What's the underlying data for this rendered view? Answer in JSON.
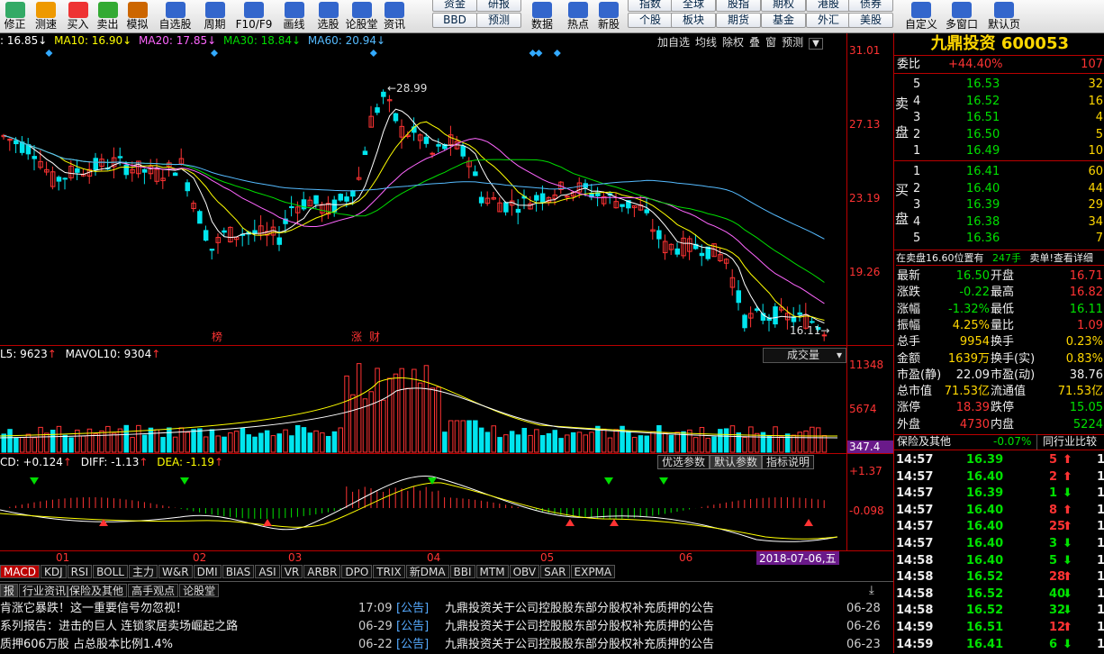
{
  "toolbar": {
    "buttons": [
      {
        "label": "修正",
        "icon": "refresh-icon",
        "color": "#3a6"
      },
      {
        "label": "测速",
        "icon": "clock-icon",
        "color": "#e90"
      },
      {
        "label": "买入",
        "icon": "buy-icon",
        "color": "#e33"
      },
      {
        "label": "卖出",
        "icon": "sell-icon",
        "color": "#3a3"
      },
      {
        "label": "模拟",
        "icon": "hammer-icon",
        "color": "#c60"
      },
      {
        "label": "自选股",
        "icon": "favorites-icon",
        "color": "#36c"
      },
      {
        "label": "周期",
        "icon": "cycle-icon",
        "color": "#36c"
      },
      {
        "label": "F10/F9",
        "icon": "f10-icon",
        "color": "#36c"
      },
      {
        "label": "画线",
        "icon": "pen-icon",
        "color": "#36c"
      },
      {
        "label": "选股",
        "icon": "filter-icon",
        "color": "#36c"
      },
      {
        "label": "论股堂",
        "icon": "forum-icon",
        "color": "#36c"
      },
      {
        "label": "资讯",
        "icon": "news-icon",
        "color": "#36c"
      }
    ],
    "small_buttons": [
      "资金",
      "研报",
      "BBD",
      "预测",
      "全球",
      "股指",
      "期货",
      "港股",
      "债券",
      "指数",
      "期权",
      "个股",
      "板块",
      "基金",
      "外汇",
      "美股"
    ],
    "right_buttons": [
      {
        "label": "数据",
        "icon": "pe-icon"
      },
      {
        "label": "热点",
        "icon": "hot-icon"
      },
      {
        "label": "新股",
        "icon": "flag-icon"
      },
      {
        "label": "自定义",
        "icon": "custom-icon"
      },
      {
        "label": "多窗口",
        "icon": "windows-icon"
      },
      {
        "label": "默认页",
        "icon": "home-icon"
      }
    ]
  },
  "ma_legend": {
    "ma5": ": 16.85",
    "ma10": "MA10: 16.90",
    "ma20": "MA20: 17.85",
    "ma30": "MA30: 18.84",
    "ma60": "MA60: 20.94"
  },
  "chart_buttons": [
    "加自选",
    "均线",
    "除权",
    "叠",
    "窗",
    "预测"
  ],
  "price_axis": [
    "31.01",
    "27.13",
    "23.19",
    "19.26"
  ],
  "price_labels": {
    "high": "28.99",
    "low": "16.11"
  },
  "markers": [
    "榜",
    "涨",
    "财"
  ],
  "vol_legend": {
    "l5": "L5: 9623",
    "mavol10": "MAVOL10: 9304"
  },
  "vol_select": "成交量",
  "vol_axis": [
    "11348",
    "5674",
    "347.4"
  ],
  "macd_legend": {
    "macd": "CD: +0.124",
    "diff": "DIFF: -1.13",
    "dea": "DEA: -1.19"
  },
  "macd_buttons": [
    "优选参数",
    "默认参数",
    "指标说明"
  ],
  "macd_axis": [
    "+1.37",
    "-0.098"
  ],
  "months": [
    "01",
    "02",
    "03",
    "04",
    "05",
    "06"
  ],
  "date_label": "2018-07-06,五",
  "indicator_tabs": [
    "MACD",
    "KDJ",
    "RSI",
    "BOLL",
    "主力",
    "W&R",
    "DMI",
    "BIAS",
    "ASI",
    "VR",
    "ARBR",
    "DPO",
    "TRIX",
    "新DMA",
    "BBI",
    "MTM",
    "OBV",
    "SAR",
    "EXPMA"
  ],
  "news_tabs": [
    "报",
    "行业资讯|保险及其他",
    "高手观点",
    "论股堂"
  ],
  "news_left": [
    {
      "text": "肯涨它暴跌！这一重要信号勿忽视！",
      "time": "17:09"
    },
    {
      "text": "系列报告：进击的巨人 连锁家居卖场崛起之路",
      "time": "06-29"
    },
    {
      "text": "质押606万股 占总股本比例1.4%",
      "time": "06-22"
    }
  ],
  "news_right": [
    {
      "tag": "[公告]",
      "text": "九鼎投资关于公司控股股东部分股权补充质押的公告",
      "time": "06-28"
    },
    {
      "tag": "[公告]",
      "text": "九鼎投资关于公司控股股东部分股权补充质押的公告",
      "time": "06-26"
    },
    {
      "tag": "[公告]",
      "text": "九鼎投资关于公司控股股东部分股权补充质押的公告",
      "time": "06-23"
    }
  ],
  "stock": {
    "name": "九鼎投资",
    "code": "600053",
    "weibi_label": "委比",
    "weibi": "+44.40%",
    "weicha": "107"
  },
  "asks": [
    {
      "n": "5",
      "p": "16.53",
      "v": "32"
    },
    {
      "n": "4",
      "p": "16.52",
      "v": "16"
    },
    {
      "n": "3",
      "p": "16.51",
      "v": "4"
    },
    {
      "n": "2",
      "p": "16.50",
      "v": "5"
    },
    {
      "n": "1",
      "p": "16.49",
      "v": "10"
    }
  ],
  "bids": [
    {
      "n": "1",
      "p": "16.41",
      "v": "60"
    },
    {
      "n": "2",
      "p": "16.40",
      "v": "44"
    },
    {
      "n": "3",
      "p": "16.39",
      "v": "29"
    },
    {
      "n": "4",
      "p": "16.38",
      "v": "34"
    },
    {
      "n": "5",
      "p": "16.36",
      "v": "7"
    }
  ],
  "sell_label": "卖盘",
  "buy_label": "买盘",
  "order_note": {
    "a": "在卖盘16.60位置有",
    "b": "247手",
    "c": "卖单!查看详细"
  },
  "quote": [
    {
      "l": "最新",
      "v": "16.50",
      "vc": "grn",
      "r": "开盘",
      "rv": "16.71",
      "rc": "red"
    },
    {
      "l": "涨跌",
      "v": "-0.22",
      "vc": "grn",
      "r": "最高",
      "rv": "16.82",
      "rc": "red"
    },
    {
      "l": "涨幅",
      "v": "-1.32%",
      "vc": "grn",
      "r": "最低",
      "rv": "16.11",
      "rc": "grn"
    },
    {
      "l": "振幅",
      "v": "4.25%",
      "vc": "yel",
      "r": "量比",
      "rv": "1.09",
      "rc": "red"
    },
    {
      "l": "总手",
      "v": "9954",
      "vc": "yel",
      "r": "换手",
      "rv": "0.23%",
      "rc": "yel"
    },
    {
      "l": "金额",
      "v": "1639万",
      "vc": "yel",
      "r": "换手(实)",
      "rv": "0.83%",
      "rc": "yel"
    },
    {
      "l": "市盈(静)",
      "v": "22.09",
      "vc": "wht",
      "r": "市盈(动)",
      "rv": "38.76",
      "rc": "wht"
    },
    {
      "l": "总市值",
      "v": "71.53亿",
      "vc": "yel",
      "r": "流通值",
      "rv": "71.53亿",
      "rc": "yel"
    },
    {
      "l": "涨停",
      "v": "18.39",
      "vc": "red",
      "r": "跌停",
      "rv": "15.05",
      "rc": "grn"
    },
    {
      "l": "外盘",
      "v": "4730",
      "vc": "red",
      "r": "内盘",
      "rv": "5224",
      "rc": "grn"
    }
  ],
  "industry": {
    "name": "保险及其他",
    "pct": "-0.07%",
    "cmp": "同行业比较"
  },
  "ticks": [
    {
      "t": "14:57",
      "p": "16.39",
      "pc": "grn",
      "v": "5",
      "d": "up"
    },
    {
      "t": "14:57",
      "p": "16.40",
      "pc": "grn",
      "v": "2",
      "d": "up"
    },
    {
      "t": "14:57",
      "p": "16.39",
      "pc": "grn",
      "v": "1",
      "d": "down"
    },
    {
      "t": "14:57",
      "p": "16.40",
      "pc": "grn",
      "v": "8",
      "d": "up"
    },
    {
      "t": "14:57",
      "p": "16.40",
      "pc": "grn",
      "v": "25",
      "d": "up"
    },
    {
      "t": "14:57",
      "p": "16.40",
      "pc": "grn",
      "v": "3",
      "d": "down"
    },
    {
      "t": "14:58",
      "p": "16.40",
      "pc": "grn",
      "v": "5",
      "d": "down"
    },
    {
      "t": "14:58",
      "p": "16.52",
      "pc": "grn",
      "v": "28",
      "d": "up"
    },
    {
      "t": "14:58",
      "p": "16.52",
      "pc": "grn",
      "v": "40",
      "d": "down"
    },
    {
      "t": "14:58",
      "p": "16.52",
      "pc": "grn",
      "v": "32",
      "d": "down"
    },
    {
      "t": "14:59",
      "p": "16.51",
      "pc": "grn",
      "v": "12",
      "d": "up"
    },
    {
      "t": "14:59",
      "p": "16.41",
      "pc": "grn",
      "v": "6",
      "d": "down"
    }
  ],
  "tick_trail": "1",
  "colors": {
    "up": "#ff3333",
    "down": "#00e000",
    "ma5": "#ffffff",
    "ma10": "#ffff00",
    "ma20": "#ff66ff",
    "ma30": "#00dd00",
    "ma60": "#55bbff",
    "cyan": "#00e5ee"
  }
}
